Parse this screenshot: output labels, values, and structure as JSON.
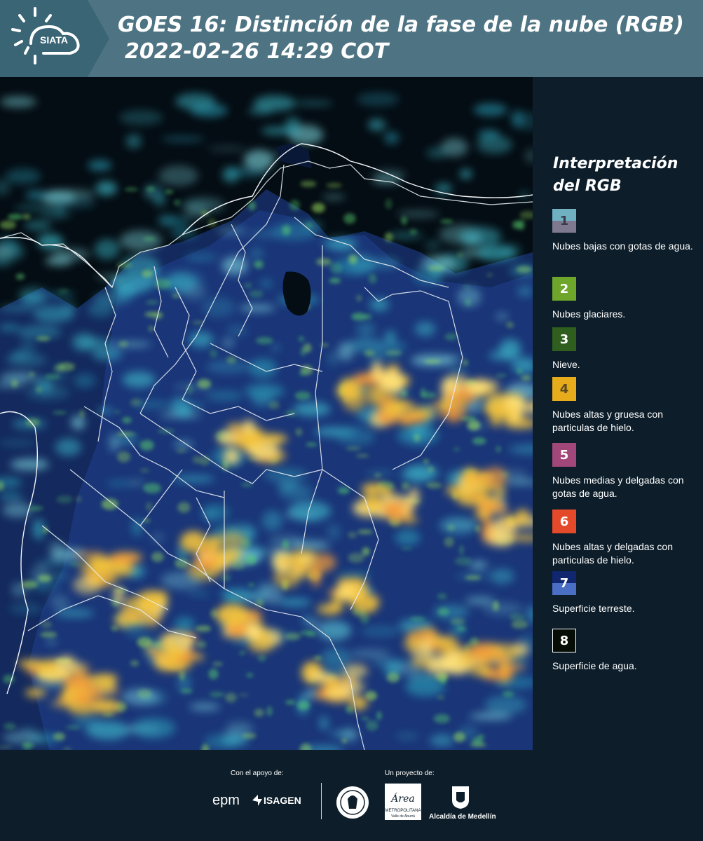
{
  "header": {
    "title_line1": "GOES 16: Distinción de la fase de la nube (RGB)",
    "title_line2": "2022-02-26 14:29 COT",
    "logo_text": "SIATA",
    "colors": {
      "bar": "#4e7483",
      "logo_panel": "#3a6575"
    }
  },
  "legend": {
    "title_line1": "Interpretación",
    "title_line2": "del RGB",
    "items": [
      {
        "number": "1",
        "label": "Nubes bajas con gotas de agua.",
        "color_top": "#6fb1c1",
        "color_bottom": "#7f7990",
        "text_color": "#3a3a4a"
      },
      {
        "number": "2",
        "label": "Nubes glaciares.",
        "color_top": "#6ea62c",
        "color_bottom": "#6ea62c",
        "text_color": "#ffffff"
      },
      {
        "number": "3",
        "label": "Nieve.",
        "color_top": "#2f5e1e",
        "color_bottom": "#2f5e1e",
        "text_color": "#ffffff"
      },
      {
        "number": "4",
        "label": "Nubes altas y gruesa con particulas de hielo.",
        "color_top": "#e6ac1c",
        "color_bottom": "#e6ac1c",
        "text_color": "#5a4a20"
      },
      {
        "number": "5",
        "label": "Nubes medias y delgadas con gotas de agua.",
        "color_top": "#a2477a",
        "color_bottom": "#a2477a",
        "text_color": "#ffffff"
      },
      {
        "number": "6",
        "label": "Nubes altas y delgadas con particulas de hielo.",
        "color_top": "#e44a2a",
        "color_bottom": "#e44a2a",
        "text_color": "#ffffff"
      },
      {
        "number": "7",
        "label": "Superficie terreste.",
        "color_top": "#10266e",
        "color_bottom": "#4a6ec4",
        "text_color": "#ffffff"
      },
      {
        "number": "8",
        "label": "Superficie de agua.",
        "color_top": "#060d06",
        "color_bottom": "#060d06",
        "text_color": "#ffffff"
      }
    ]
  },
  "footer": {
    "support_label": "Con el apoyo de:",
    "project_label": "Un proyecto de:",
    "epm_text": "epm",
    "isagen_text": "ISAGEN",
    "metro_title": "Área",
    "metro_line1": "METROPOLITANA",
    "metro_line2": "Valle de Aburrá",
    "alcaldia_text": "Alcaldía de Medellín"
  },
  "map": {
    "colors": {
      "water": "#050d14",
      "land": "#16306a",
      "cyan": "#40c8c8",
      "yellow": "#f0c040",
      "orange": "#e87038",
      "green": "#5ad06a",
      "border": "#e8eef2"
    }
  }
}
